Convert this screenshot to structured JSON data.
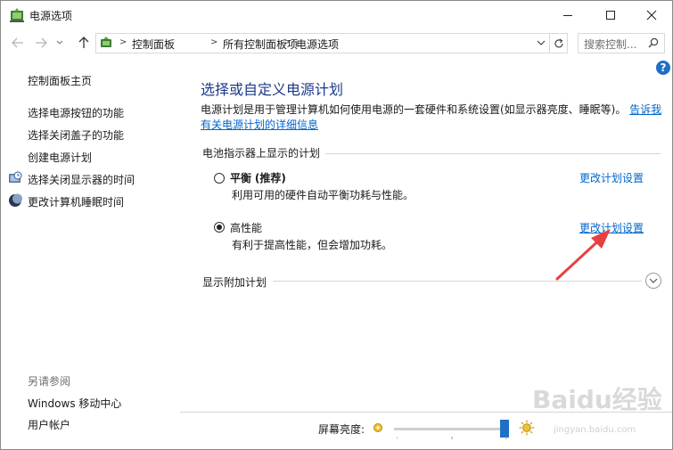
{
  "window": {
    "title": "电源选项"
  },
  "address": {
    "crumbs": [
      "控制面板",
      "所有控制面板项",
      "电源选项"
    ],
    "search_placeholder": "搜索控制..."
  },
  "help": {
    "label": "?"
  },
  "sidebar": {
    "links": [
      "控制面板主页",
      "选择电源按钮的功能",
      "选择关闭盖子的功能",
      "创建电源计划",
      "选择关闭显示器的时间",
      "更改计算机睡眠时间"
    ],
    "see_also_label": "另请参阅",
    "see_also": [
      "Windows 移动中心",
      "用户帐户"
    ]
  },
  "main": {
    "title": "选择或自定义电源计划",
    "description": "电源计划是用于管理计算机如何使用电源的一套硬件和系统设置(如显示器亮度、睡眠等)。",
    "description_link": "告诉我有关电源计划的详细信息",
    "group_label": "电池指示器上显示的计划",
    "plans": [
      {
        "name": "平衡",
        "tag": "(推荐)",
        "desc": "利用可用的硬件自动平衡功耗与性能。",
        "selected": false,
        "change": "更改计划设置"
      },
      {
        "name": "高性能",
        "tag": "",
        "desc": "有利于提高性能，但会增加功耗。",
        "selected": true,
        "change": "更改计划设置"
      }
    ],
    "additional_label": "显示附加计划"
  },
  "brightness": {
    "label": "屏幕亮度:",
    "level": 0.97
  },
  "watermark": {
    "brand": "Baidu经验",
    "url": "jingyan.baidu.com"
  },
  "colors": {
    "link": "#0066cc",
    "title": "#1c3a8c",
    "accent": "#1f6fc5",
    "arrow": "#e84040"
  }
}
